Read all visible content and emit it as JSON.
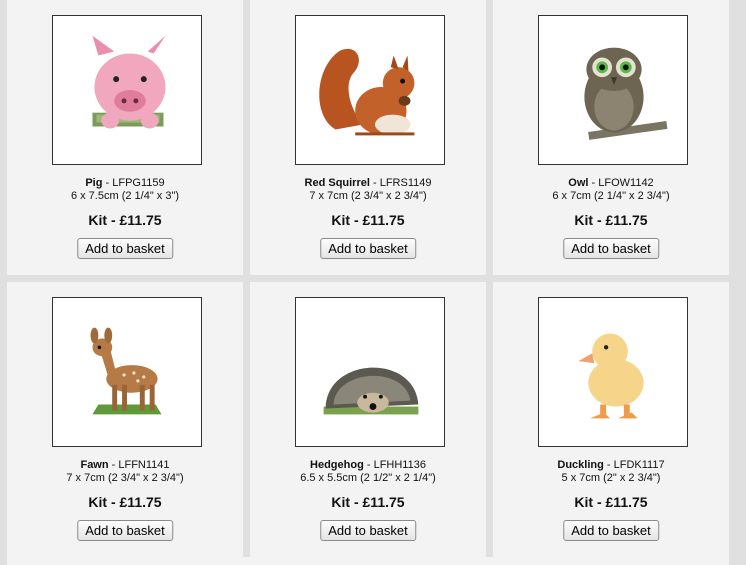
{
  "products": [
    {
      "name": "Pig",
      "code": "LFPG1159",
      "size": "6 x 7.5cm (2 1/4\" x 3\")",
      "price": "Kit - £11.75",
      "button": "Add to basket",
      "image_icon": "pig-icon"
    },
    {
      "name": "Red Squirrel",
      "code": "LFRS1149",
      "size": "7 x 7cm (2 3/4\" x 2 3/4\")",
      "price": "Kit - £11.75",
      "button": "Add to basket",
      "image_icon": "squirrel-icon"
    },
    {
      "name": "Owl",
      "code": "LFOW1142",
      "size": "6 x 7cm (2 1/4\" x 2 3/4\")",
      "price": "Kit - £11.75",
      "button": "Add to basket",
      "image_icon": "owl-icon"
    },
    {
      "name": "Fawn",
      "code": "LFFN1141",
      "size": "7 x 7cm (2 3/4\" x 2 3/4\")",
      "price": "Kit - £11.75",
      "button": "Add to basket",
      "image_icon": "fawn-icon"
    },
    {
      "name": "Hedgehog",
      "code": "LFHH1136",
      "size": "6.5 x 5.5cm (2 1/2\" x 2 1/4\")",
      "price": "Kit - £11.75",
      "button": "Add to basket",
      "image_icon": "hedgehog-icon"
    },
    {
      "name": "Duckling",
      "code": "LFDK1117",
      "size": "5 x 7cm (2\" x 2 3/4\")",
      "price": "Kit - £11.75",
      "button": "Add to basket",
      "image_icon": "duckling-icon"
    }
  ],
  "separator": " - ",
  "colors": {
    "page_bg": "#e0e0e0",
    "card_bg": "#f3f3f3",
    "thumb_bg": "#ffffff"
  }
}
